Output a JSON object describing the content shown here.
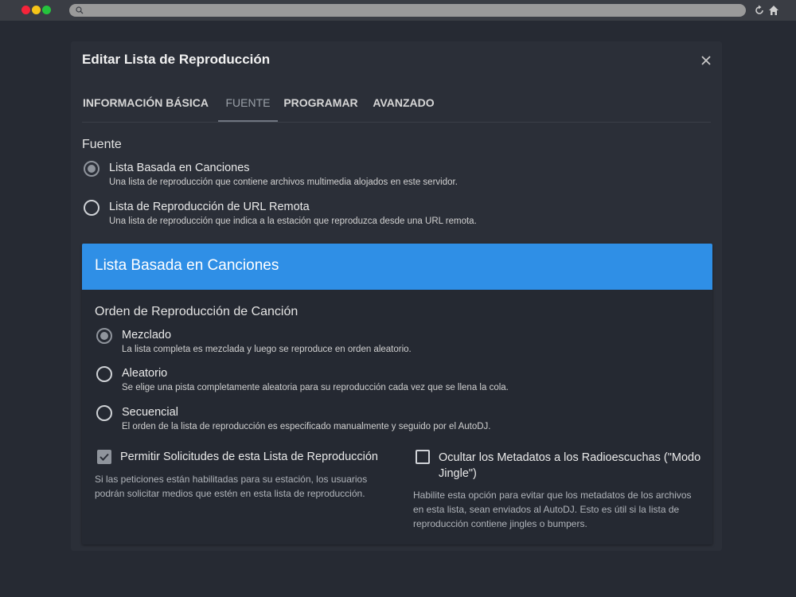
{
  "browser": {
    "traffic_lights": [
      "#f5243a",
      "#f5c518",
      "#25c33d"
    ]
  },
  "modal": {
    "title": "Editar Lista de Reproducción",
    "tabs": [
      {
        "label": "INFORMACIÓN BÁSICA",
        "active": false
      },
      {
        "label": "FUENTE",
        "active": true
      },
      {
        "label": "PROGRAMAR",
        "active": false
      },
      {
        "label": "AVANZADO",
        "active": false
      }
    ],
    "source": {
      "label": "Fuente",
      "options": [
        {
          "label": "Lista Basada en Canciones",
          "description": "Una lista de reproducción que contiene archivos multimedia alojados en este servidor.",
          "selected": true
        },
        {
          "label": "Lista de Reproducción de URL Remota",
          "description": "Una lista de reproducción que indica a la estación que reproduzca desde una URL remota.",
          "selected": false
        }
      ]
    },
    "panel": {
      "title": "Lista Basada en Canciones",
      "header_color": "#2f8fe6",
      "order": {
        "label": "Orden de Reproducción de Canción",
        "options": [
          {
            "label": "Mezclado",
            "description": "La lista completa es mezclada y luego se reproduce en orden aleatorio.",
            "selected": true
          },
          {
            "label": "Aleatorio",
            "description": "Se elige una pista completamente aleatoria para su reproducción cada vez que se llena la cola.",
            "selected": false
          },
          {
            "label": "Secuencial",
            "description": "El orden de la lista de reproducción es especificado manualmente y seguido por el AutoDJ.",
            "selected": false
          }
        ]
      },
      "allow_requests": {
        "label": "Permitir Solicitudes de esta Lista de Reproducción",
        "checked": true,
        "help_line1": "Si las peticiones están habilitadas para su estación, los usuarios",
        "help_line2": "podrán solicitar medios que estén en esta lista de reproducción."
      },
      "hide_metadata": {
        "label_line1": "Ocultar los Metadatos a los Radioescuchas (\"Modo",
        "label_line2": "Jingle\")",
        "checked": false,
        "help_line1": "Habilite esta opción para evitar que los metadatos de los archivos",
        "help_line2": "en esta lista, sean enviados al AutoDJ. Esto es útil si la lista de",
        "help_line3": "reproducción contiene jingles o bumpers."
      }
    }
  }
}
